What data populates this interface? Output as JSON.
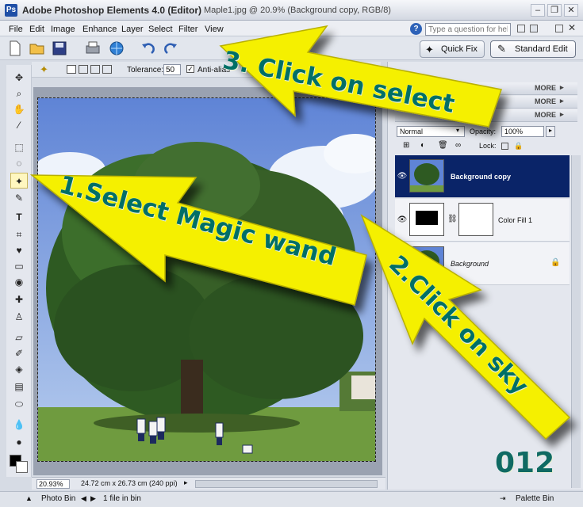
{
  "window": {
    "app_title": "Adobe Photoshop Elements 4.0 (Editor)",
    "doc_title": "Maple1.jpg @ 20.9% (Background copy, RGB/8)",
    "logo_text": "Ps",
    "controls": [
      "–",
      "❐",
      "✕"
    ]
  },
  "menu": {
    "items": [
      "File",
      "Edit",
      "Image",
      "Enhance",
      "Layer",
      "Select",
      "Filter",
      "View"
    ],
    "help_placeholder": "Type a question for help",
    "help_icon": "?"
  },
  "modes": {
    "quick_fix": "Quick Fix",
    "standard_edit": "Standard Edit"
  },
  "options": {
    "tolerance_label": "Tolerance:",
    "tolerance_value": "50",
    "antialias_label": "Anti-alias"
  },
  "palette": {
    "more_label": "MORE",
    "blend_mode": "Normal",
    "opacity_label": "Opacity:",
    "opacity_value": "100%",
    "lock_label": "Lock:",
    "layers": [
      {
        "name": "Background copy"
      },
      {
        "name": "Color Fill 1"
      },
      {
        "name": "Background"
      }
    ]
  },
  "status": {
    "zoom": "20.93%",
    "doc_size": "24.72 cm x 26.73 cm (240 ppi)"
  },
  "photobin": {
    "label": "Photo Bin",
    "count": "1 file in bin",
    "palette_bin": "Palette Bin"
  },
  "callouts": {
    "step1": "1.Select Magic wand",
    "step2": "2.Click on sky",
    "step3": "3. Click on select",
    "page_number": "012"
  },
  "colors": {
    "selected_layer": "#0a2468",
    "arrow_fill": "#f5f000",
    "callout_text": "#006f66"
  }
}
